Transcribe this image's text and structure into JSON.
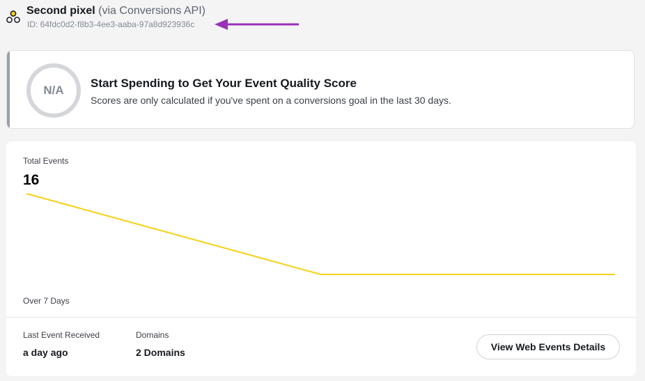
{
  "pixel": {
    "name": "Second pixel",
    "via": "(via Conversions API)",
    "id_text": "ID: 64fdc0d2-f8b3-4ee3-aaba-97a8d923936c",
    "icon": "pixel-icon"
  },
  "annotation": {
    "color": "#9b30b8"
  },
  "quality": {
    "score": "N/A",
    "title": "Start Spending to Get Your Event Quality Score",
    "subtitle": "Scores are only calculated if you've spent on a conversions goal in the last 30 days."
  },
  "events": {
    "total_label": "Total Events",
    "total_value": "16",
    "period_label": "Over 7 Days",
    "last_event_label": "Last Event Received",
    "last_event_value": "a day ago",
    "domains_label": "Domains",
    "domains_value": "2 Domains",
    "details_button": "View Web Events Details"
  },
  "chart_data": {
    "type": "line",
    "color": "#f7d117",
    "series": [
      {
        "points": [
          {
            "x": 0,
            "y": 16
          },
          {
            "x": 0.5,
            "y": 1
          },
          {
            "x": 1,
            "y": 1
          }
        ]
      }
    ]
  }
}
